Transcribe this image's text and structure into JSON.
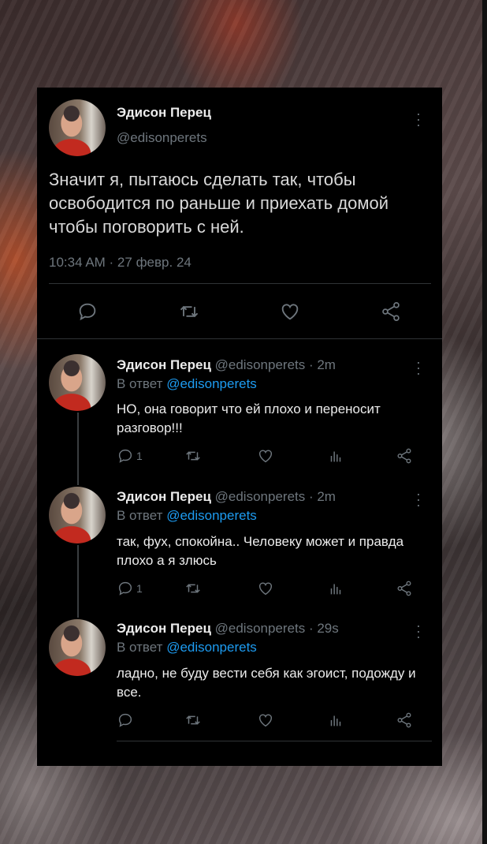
{
  "main_tweet": {
    "name": "Эдисон Перец",
    "handle": "@edisonperets",
    "text": "Значит я, пытаюсь сделать так, чтобы освободится по раньше и приехать домой чтобы поговорить с ней.",
    "time": "10:34 AM · 27 февр. 24"
  },
  "replies": [
    {
      "name": "Эдисон Перец",
      "handle_time": "@edisonperets · 2m",
      "reply_prefix": "В ответ",
      "reply_to": "@edisonperets",
      "text": "НО, она говорит что ей плохо и переносит разговор!!!",
      "reply_count": "1"
    },
    {
      "name": "Эдисон Перец",
      "handle_time": "@edisonperets · 2m",
      "reply_prefix": "В ответ",
      "reply_to": "@edisonperets",
      "text": " так, фух, спокойна.. Человеку может и правда плохо а я злюсь",
      "reply_count": "1"
    },
    {
      "name": "Эдисон Перец",
      "handle_time": "@edisonperets · 29s",
      "reply_prefix": "В ответ",
      "reply_to": "@edisonperets",
      "text": "ладно, не буду вести себя как эгоист, подожду и все.",
      "reply_count": ""
    }
  ],
  "icons": [
    "reply-icon",
    "retweet-icon",
    "like-icon",
    "share-icon",
    "analytics-icon",
    "more-icon"
  ],
  "colors": {
    "background": "#000000",
    "text": "#d9d9d9",
    "muted": "#6e767d",
    "link": "#1d9bf0"
  }
}
